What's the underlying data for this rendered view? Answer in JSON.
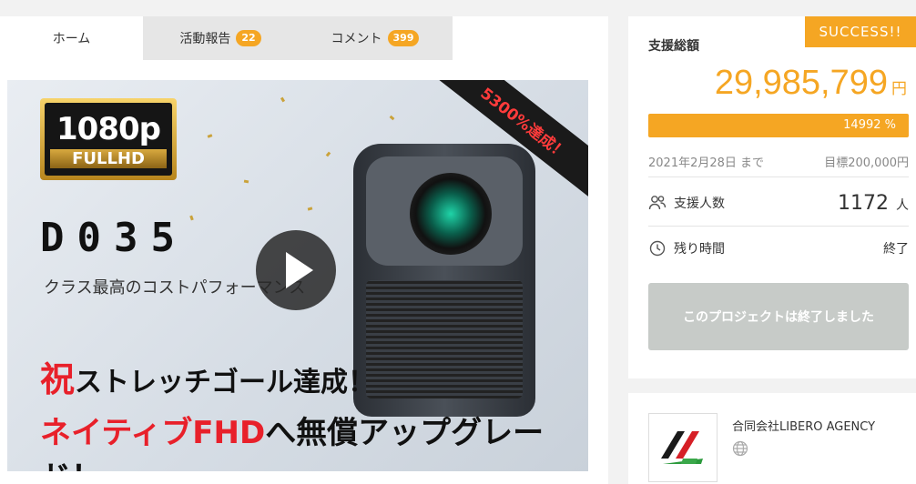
{
  "tabs": [
    {
      "label": "ホーム"
    },
    {
      "label": "活動報告",
      "badge": "22"
    },
    {
      "label": "コメント",
      "badge": "399"
    }
  ],
  "hero": {
    "badge_top": "1080p",
    "badge_bottom": "FULLHD",
    "model": "D035",
    "tagline": "クラス最高のコストパフォーマンス",
    "ribbon": "5300%達成！",
    "line1_big": "祝",
    "line1_rest": "ストレッチゴール達成！",
    "line2_red": "ネイティブFHD",
    "line2_rest": "へ無償アップグレード！"
  },
  "status": {
    "success": "SUCCESS!!",
    "label": "支援総額",
    "amount": "29,985,799",
    "currency": "円",
    "progress_text": "14992 %",
    "deadline": "2021年2月28日 まで",
    "goal": "目標200,000円",
    "supporters_label": "支援人数",
    "supporters_value": "1172",
    "supporters_unit": "人",
    "remaining_label": "残り時間",
    "remaining_value": "終了",
    "ended_button": "このプロジェクトは終了しました"
  },
  "owner": {
    "name": "合同会社LIBERO AGENCY"
  },
  "colors": {
    "accent": "#f5a623",
    "red": "#e8202a"
  }
}
